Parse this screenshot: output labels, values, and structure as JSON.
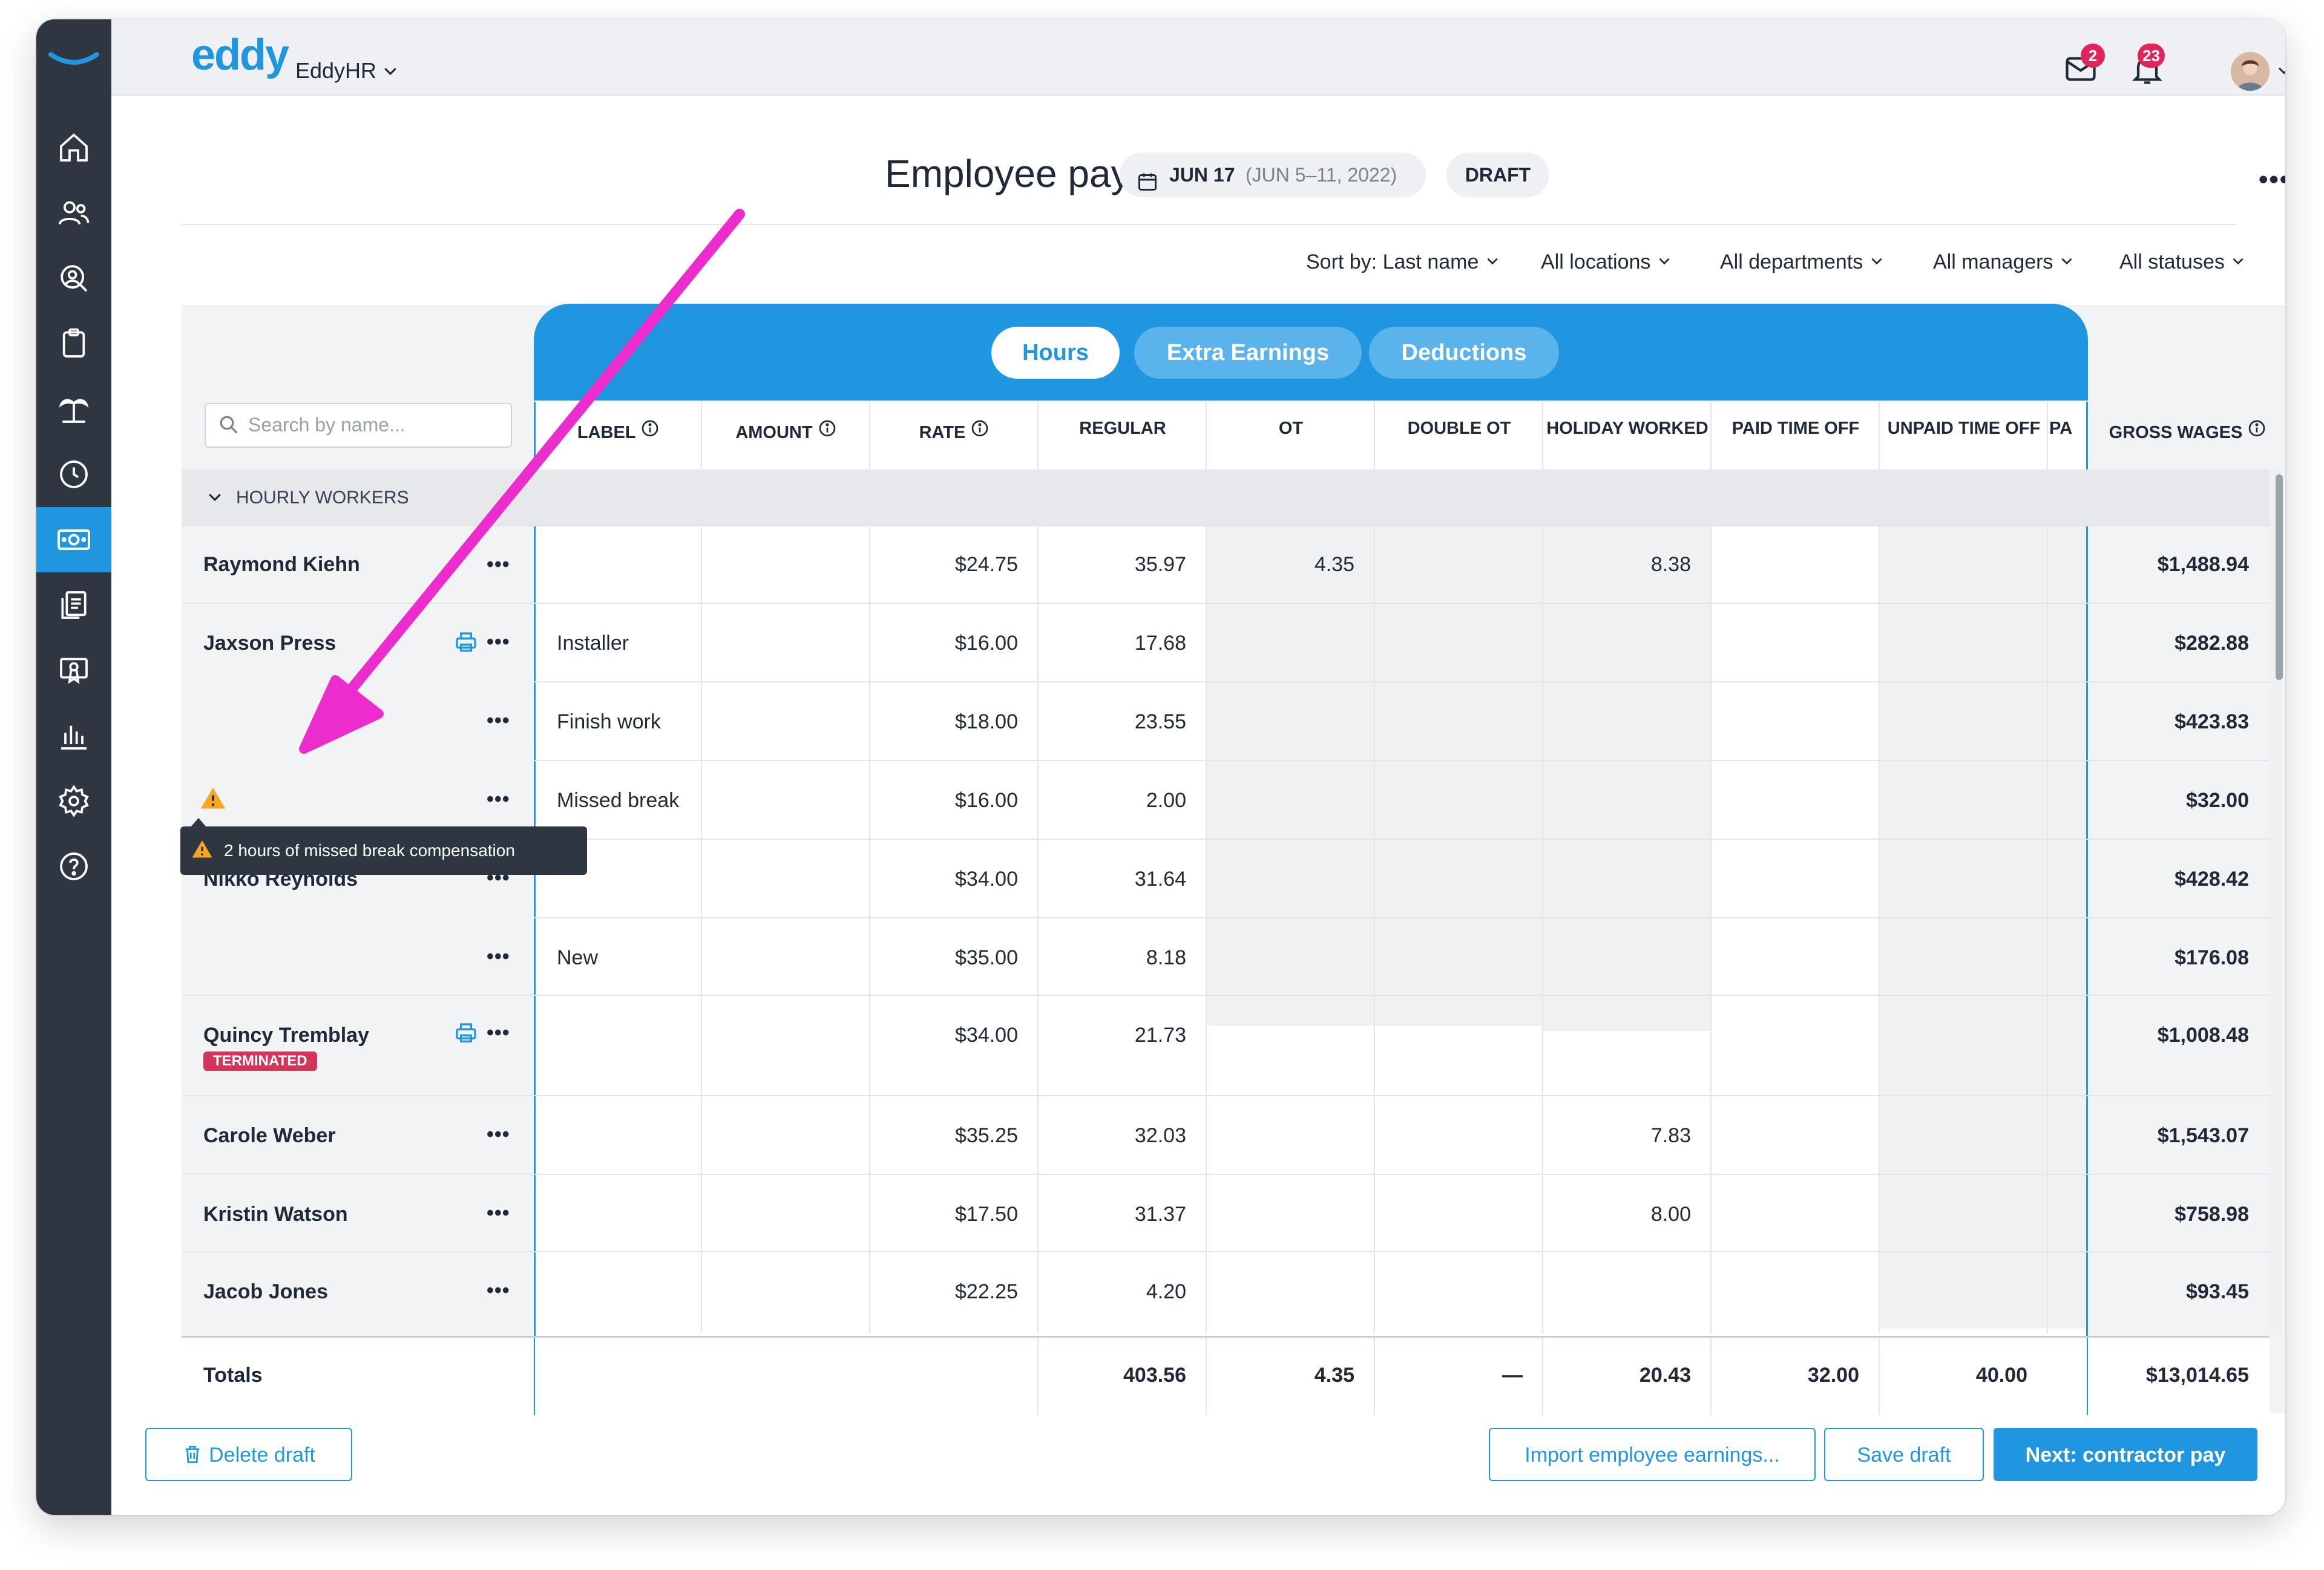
{
  "app": {
    "brand": "eddy",
    "company": "EddyHR",
    "mail_badge": "2",
    "notif_badge": "23"
  },
  "page": {
    "title": "Employee pay",
    "period_date": "JUN 17",
    "period_range": "(JUN 5–11, 2022)",
    "status": "DRAFT"
  },
  "filters": {
    "sort": "Sort by: Last name",
    "locations": "All locations",
    "departments": "All departments",
    "managers": "All managers",
    "statuses": "All statuses"
  },
  "tabs": [
    "Hours",
    "Extra Earnings",
    "Deductions"
  ],
  "search": {
    "placeholder": "Search by name..."
  },
  "columns": [
    "LABEL",
    "AMOUNT",
    "RATE",
    "REGULAR",
    "OT",
    "DOUBLE OT",
    "HOLIDAY WORKED",
    "PAID TIME OFF",
    "UNPAID TIME OFF",
    "PA",
    "GROSS WAGES"
  ],
  "group": "HOURLY WORKERS",
  "rows": [
    {
      "name": "Raymond Kiehn",
      "label": "",
      "rate": "$24.75",
      "regular": "35.97",
      "ot": "4.35",
      "holiday": "8.38",
      "gross": "$1,488.94"
    },
    {
      "name": "Jaxson Press",
      "label": "Installer",
      "rate": "$16.00",
      "regular": "17.68",
      "ot": "",
      "holiday": "",
      "gross": "$282.88"
    },
    {
      "name": "",
      "label": "Finish work",
      "rate": "$18.00",
      "regular": "23.55",
      "ot": "",
      "holiday": "",
      "gross": "$423.83"
    },
    {
      "name": "",
      "label": "Missed break",
      "rate": "$16.00",
      "regular": "2.00",
      "ot": "",
      "holiday": "",
      "gross": "$32.00"
    },
    {
      "name": "Nikko Reynolds",
      "label": "",
      "rate": "$34.00",
      "regular": "31.64",
      "ot": "",
      "holiday": "",
      "gross": "$428.42"
    },
    {
      "name": "",
      "label": "New",
      "rate": "$35.00",
      "regular": "8.18",
      "ot": "",
      "holiday": "",
      "gross": "$176.08"
    },
    {
      "name": "Quincy Tremblay",
      "label": "",
      "rate": "$34.00",
      "regular": "21.73",
      "ot": "",
      "holiday": "",
      "gross": "$1,008.48"
    },
    {
      "name": "Carole Weber",
      "label": "",
      "rate": "$35.25",
      "regular": "32.03",
      "ot": "",
      "holiday": "7.83",
      "gross": "$1,543.07"
    },
    {
      "name": "Kristin Watson",
      "label": "",
      "rate": "$17.50",
      "regular": "31.37",
      "ot": "",
      "holiday": "8.00",
      "gross": "$758.98"
    },
    {
      "name": "Jacob Jones",
      "label": "",
      "rate": "$22.25",
      "regular": "4.20",
      "ot": "",
      "holiday": "",
      "gross": "$93.45"
    }
  ],
  "terminated_label": "TERMINATED",
  "tooltip": "2 hours of missed break compensation",
  "totals": {
    "label": "Totals",
    "regular": "403.56",
    "ot": "4.35",
    "double_ot": "—",
    "holiday": "20.43",
    "pto": "32.00",
    "unpaid": "40.00",
    "gross": "$13,014.65"
  },
  "footer": {
    "delete": "Delete draft",
    "import": "Import employee earnings...",
    "save": "Save draft",
    "next": "Next: contractor pay"
  },
  "colors": {
    "accent": "#2196e0",
    "sidebar": "#2e3741",
    "annotation": "#ec2ccd",
    "warning": "#f5a623",
    "badge": "#e0245e"
  }
}
